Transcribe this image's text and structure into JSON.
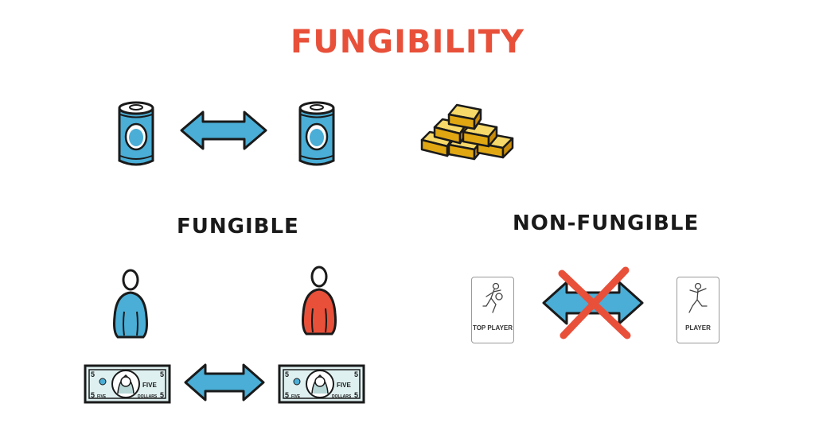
{
  "title": "FUNGIBILITY",
  "labels": {
    "fungible": "FUNGIBLE",
    "non_fungible": "NON-FUNGIBLE"
  },
  "cards": {
    "left": "TOP PLAYER",
    "right": "PLAYER"
  },
  "bills": {
    "denomination_numeral": "5",
    "word": "FIVE",
    "currency_word": "DOLLARS"
  },
  "colors": {
    "title": "#e8503a",
    "blue": "#4aaed6",
    "red": "#e8503a",
    "gold": "#f2c21b",
    "outline": "#1a1a1a",
    "bill": "#dff0f0"
  },
  "icons": [
    "can-icon",
    "double-arrow-icon",
    "gold-bars-icon",
    "person-icon",
    "dollar-bill-icon",
    "player-card-icon",
    "cross-icon"
  ]
}
